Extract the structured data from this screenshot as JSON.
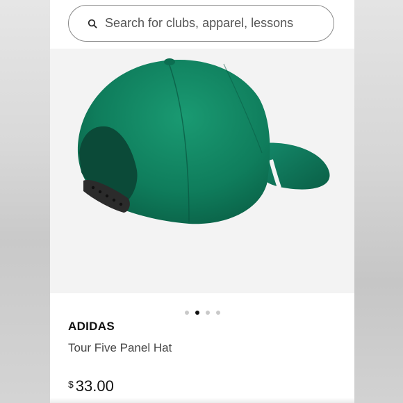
{
  "search": {
    "placeholder": "Search for clubs, apparel, lessons"
  },
  "carousel": {
    "total": 4,
    "active": 2
  },
  "product": {
    "brand": "ADIDAS",
    "name": "Tour Five Panel Hat",
    "currency": "$",
    "price": "33.00",
    "image_icon": "green-cap-image"
  },
  "colors": {
    "cap_green": "#0e7a5a",
    "background": "#f3f3f3"
  }
}
